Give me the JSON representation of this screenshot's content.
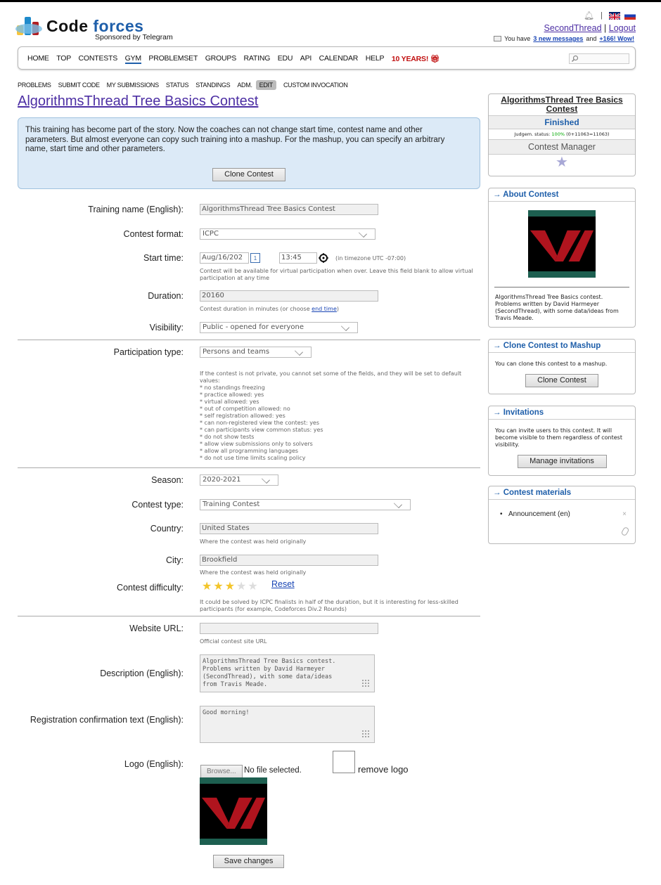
{
  "header": {
    "logo_word_a": "Code",
    "logo_word_b": "forces",
    "sponsor": "Sponsored by Telegram",
    "user": "SecondThread",
    "separator": "|",
    "logout": "Logout",
    "msg_prefix": "You have",
    "msg_link": "3 new messages",
    "msg_and": "and",
    "msg_wow": "+166! Wow!"
  },
  "nav": {
    "items": [
      "HOME",
      "TOP",
      "CONTESTS",
      "GYM",
      "PROBLEMSET",
      "GROUPS",
      "RATING",
      "EDU",
      "API",
      "CALENDAR",
      "HELP"
    ],
    "special": "10 YEARS!"
  },
  "subnav": [
    "PROBLEMS",
    "SUBMIT CODE",
    "MY SUBMISSIONS",
    "STATUS",
    "STANDINGS",
    "ADM.",
    "EDIT",
    "CUSTOM INVOCATION"
  ],
  "page_title": "AlgorithmsThread Tree Basics Contest",
  "notice": {
    "text": "This training has become part of the story. Now the coaches can not change start time, contest name and other parameters. But almost everyone can copy such training into a mashup. For the mashup, you can specify an arbitrary name, start time and other parameters.",
    "button": "Clone Contest"
  },
  "form": {
    "name_label": "Training name (English):",
    "name_value": "AlgorithmsThread Tree Basics Contest",
    "format_label": "Contest format:",
    "format_value": "ICPC",
    "start_label": "Start time:",
    "start_date": "Aug/16/202",
    "start_time": "13:45",
    "timezone": "(in timezone UTC -07:00)",
    "start_hint": "Contest will be available for virtual participation when over. Leave this field blank to allow virtual participation at any time",
    "duration_label": "Duration:",
    "duration_value": "20160",
    "duration_hint": "Contest duration in minutes (or choose",
    "duration_hint_link": "end time",
    "duration_hint_end": ")",
    "visibility_label": "Visibility:",
    "visibility_value": "Public - opened for everyone",
    "ptype_label": "Participation type:",
    "ptype_value": "Persons and teams",
    "ptype_hint": [
      "If the contest is not private, you cannot set some of the fields, and they will be set to default values:",
      "* no standings freezing",
      "* practice allowed: yes",
      "* virtual allowed: yes",
      "* out of competition allowed: no",
      "* self registration allowed: yes",
      "* can non-registered view the contest: yes",
      "* can participants view common status: yes",
      "* do not show tests",
      "* allow view submissions only to solvers",
      "* allow all programming languages",
      "* do not use time limits scaling policy"
    ],
    "season_label": "Season:",
    "season_value": "2020-2021",
    "ctype_label": "Contest type:",
    "ctype_value": "Training Contest",
    "country_label": "Country:",
    "country_value": "United States",
    "country_hint": "Where the contest was held originally",
    "city_label": "City:",
    "city_value": "Brookfield",
    "city_hint": "Where the contest was held originally",
    "difficulty_label": "Contest difficulty:",
    "difficulty_stars": 3,
    "difficulty_max": 5,
    "reset": "Reset",
    "difficulty_hint": "It could be solved by ICPC finalists in half of the duration, but it is interesting for less-skilled participants (for example, Codeforces Div.2 Rounds)",
    "website_label": "Website URL:",
    "website_value": "",
    "website_hint": "Official contest site URL",
    "desc_label": "Description (English):",
    "desc_value": "AlgorithmsThread Tree Basics contest.\nProblems written by David Harmeyer\n(SecondThread), with some data/ideas\nfrom Travis Meade.",
    "reg_label": "Registration confirmation text (English):",
    "reg_value": "Good morning!",
    "logo_label": "Logo (English):",
    "browse": "Browse...",
    "no_file": "No file selected.",
    "remove_logo": "remove logo",
    "save": "Save changes"
  },
  "sidebar": {
    "contest_name": "AlgorithmsThread Tree Basics Contest",
    "status": "Finished",
    "judgement_prefix": "Judgem. status:",
    "judgement_pct": "100%",
    "judgement_counts": "(0+11063=11063)",
    "manager": "Contest Manager",
    "about_title": "→ About Contest",
    "about_text": "AlgorithmsThread Tree Basics contest. Problems written by David Harmeyer (SecondThread), with some data/ideas from Travis Meade.",
    "clone_title": "→ Clone Contest to Mashup",
    "clone_text": "You can clone this contest to a mashup.",
    "clone_button": "Clone Contest",
    "inv_title": "→ Invitations",
    "inv_text": "You can invite users to this contest. It will become visible to them regardless of contest visibility.",
    "inv_button": "Manage invitations",
    "mat_title": "→ Contest materials",
    "mat_item": "Announcement (en)",
    "mat_delete": "×"
  },
  "colors": {
    "link": "#4d2fa4",
    "accent": "#1f5faa",
    "special": "#c10f0f",
    "notice_bg": "#dceaf7",
    "logo_red": "#b0141e",
    "logo_teal": "#1d5f50"
  }
}
